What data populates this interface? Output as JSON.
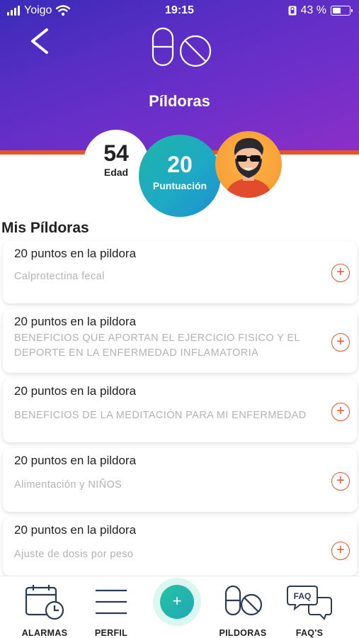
{
  "status_bar": {
    "carrier": "Yoigo",
    "time": "19:15",
    "battery_percent": "43 %",
    "battery_level": 0.43
  },
  "header": {
    "title": "Píldoras",
    "back_icon": "chevron-left-icon",
    "header_icon": "pills-icon",
    "colors": {
      "gradient_start": "#3a2bb8",
      "gradient_end": "#8a2fc8",
      "accent": "#e8542a"
    }
  },
  "stats": {
    "age_value": "54",
    "age_label": "Edad",
    "score_value": "20",
    "score_label": "Puntuación"
  },
  "section": {
    "title": "Mis Píldoras"
  },
  "pills": [
    {
      "title": "20 puntos en la pildora",
      "description": "Calprotectina fecal"
    },
    {
      "title": "20 puntos en la pildora",
      "description": "BENEFICIOS QUE APORTAN EL EJERCICIO FISICO Y EL DEPORTE EN LA ENFERMEDAD INFLAMATORIA"
    },
    {
      "title": "20 puntos en la pildora",
      "description": "BENEFICIOS DE LA MEDITACIÓN PARA MI ENFERMEDAD"
    },
    {
      "title": "20 puntos en la pildora",
      "description": "Alimentación y NIÑOS"
    },
    {
      "title": "20 puntos en la pildora",
      "description": "Ajuste de dosis por peso"
    }
  ],
  "add_symbol": "+",
  "bottom_nav": {
    "items": [
      {
        "label": "ALARMAS",
        "icon": "calendar-clock-icon"
      },
      {
        "label": "PERFIL",
        "icon": "menu-lines-icon"
      },
      {
        "label": "PILDORAS",
        "icon": "pills-icon"
      },
      {
        "label": "FAQ'S",
        "icon": "faq-chat-icon"
      }
    ],
    "fab_symbol": "+",
    "faq_badge": "FAQ"
  }
}
